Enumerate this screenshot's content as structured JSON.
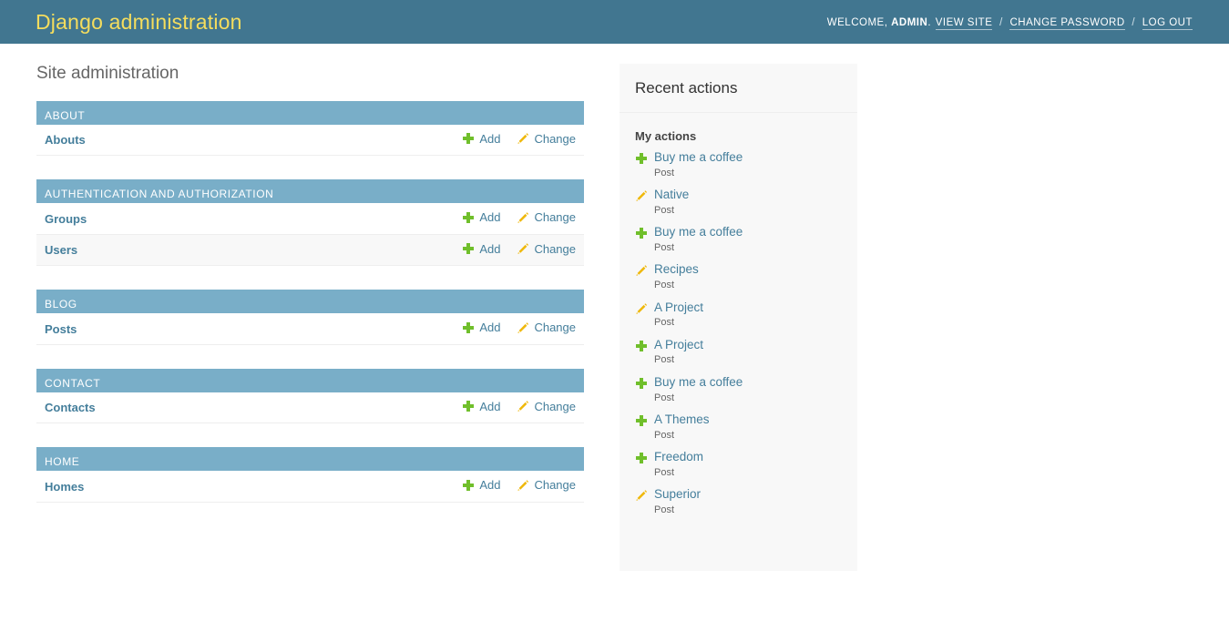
{
  "header": {
    "branding_title": "Django administration",
    "welcome_label": "WELCOME,",
    "username": "ADMIN",
    "welcome_period": ".",
    "view_site_label": "VIEW SITE",
    "separator": "/",
    "change_password_label": "CHANGE PASSWORD",
    "log_out_label": "LOG OUT",
    "brand_color": "#417690",
    "brand_text_color": "#f5dd5d"
  },
  "page": {
    "title": "Site administration",
    "caption_color": "#79aec8",
    "link_color": "#447e9b",
    "add_icon_color": "#70bf2b",
    "change_icon_color": "#efb80b"
  },
  "apps": [
    {
      "name": "ABOUT",
      "models": [
        {
          "label": "Abouts",
          "add_label": "Add",
          "change_label": "Change",
          "add_icon": "plus-icon",
          "change_icon": "pencil-icon"
        }
      ]
    },
    {
      "name": "AUTHENTICATION AND AUTHORIZATION",
      "models": [
        {
          "label": "Groups",
          "add_label": "Add",
          "change_label": "Change",
          "add_icon": "plus-icon",
          "change_icon": "pencil-icon"
        },
        {
          "label": "Users",
          "add_label": "Add",
          "change_label": "Change",
          "add_icon": "plus-icon",
          "change_icon": "pencil-icon"
        }
      ]
    },
    {
      "name": "BLOG",
      "models": [
        {
          "label": "Posts",
          "add_label": "Add",
          "change_label": "Change",
          "add_icon": "plus-icon",
          "change_icon": "pencil-icon"
        }
      ]
    },
    {
      "name": "CONTACT",
      "models": [
        {
          "label": "Contacts",
          "add_label": "Add",
          "change_label": "Change",
          "add_icon": "plus-icon",
          "change_icon": "pencil-icon"
        }
      ]
    },
    {
      "name": "HOME",
      "models": [
        {
          "label": "Homes",
          "add_label": "Add",
          "change_label": "Change",
          "add_icon": "plus-icon",
          "change_icon": "pencil-icon"
        }
      ]
    }
  ],
  "sidebar": {
    "title": "Recent actions",
    "subtitle": "My actions",
    "actions": [
      {
        "icon": "plus-icon",
        "type": "addition",
        "label": "Buy me a coffee",
        "content_type": "Post"
      },
      {
        "icon": "pencil-icon",
        "type": "change",
        "label": "Native",
        "content_type": "Post"
      },
      {
        "icon": "plus-icon",
        "type": "addition",
        "label": "Buy me a coffee",
        "content_type": "Post"
      },
      {
        "icon": "pencil-icon",
        "type": "change",
        "label": "Recipes",
        "content_type": "Post"
      },
      {
        "icon": "pencil-icon",
        "type": "change",
        "label": "A Project",
        "content_type": "Post"
      },
      {
        "icon": "plus-icon",
        "type": "addition",
        "label": "A Project",
        "content_type": "Post"
      },
      {
        "icon": "plus-icon",
        "type": "addition",
        "label": "Buy me a coffee",
        "content_type": "Post"
      },
      {
        "icon": "plus-icon",
        "type": "addition",
        "label": "A Themes",
        "content_type": "Post"
      },
      {
        "icon": "plus-icon",
        "type": "addition",
        "label": "Freedom",
        "content_type": "Post"
      },
      {
        "icon": "pencil-icon",
        "type": "change",
        "label": "Superior",
        "content_type": "Post"
      }
    ]
  }
}
